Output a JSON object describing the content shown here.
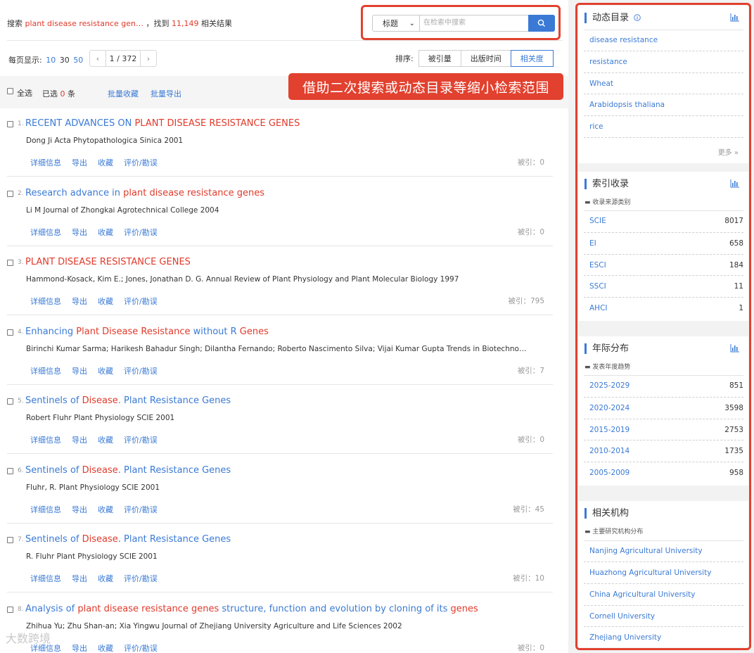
{
  "summary": {
    "prefix": "搜索",
    "keyword": "plant disease resistance gen…",
    "mid": "，找到",
    "count": "11,149",
    "suffix": "相关结果"
  },
  "search": {
    "field": "标题",
    "placeholder": "在检索中搜索"
  },
  "pagination": {
    "per_page_label": "每页显示:",
    "options": [
      "10",
      "30",
      "50"
    ],
    "current_page": "1 / 372",
    "prev": "‹",
    "next": "›"
  },
  "sort": {
    "label": "排序:",
    "options": [
      "被引量",
      "出版时间",
      "相关度"
    ],
    "active": "相关度"
  },
  "toolbar": {
    "select_all": "全选",
    "selected_prefix": "已选",
    "selected_count": "0",
    "selected_suffix": "条",
    "batch_collect": "批量收藏",
    "batch_export": "批量导出"
  },
  "callout": "借助二次搜索或动态目录等缩小检索范围",
  "result_actions": [
    "详细信息",
    "导出",
    "收藏",
    "评价/勘误"
  ],
  "cited_label": "被引：",
  "results": [
    {
      "num": "1.",
      "title": [
        {
          "t": "RECENT ADVANCES ON ",
          "hl": false
        },
        {
          "t": "PLANT DISEASE RESISTANCE GENES",
          "hl": true
        }
      ],
      "meta": "Dong Ji Acta Phytopathologica Sinica 2001",
      "cited": "0"
    },
    {
      "num": "2.",
      "title": [
        {
          "t": "Research advance in ",
          "hl": false
        },
        {
          "t": "plant disease resistance genes",
          "hl": true
        }
      ],
      "meta": "Li M Journal of Zhongkai Agrotechnical College 2004",
      "cited": "0"
    },
    {
      "num": "3.",
      "title": [
        {
          "t": "PLANT DISEASE RESISTANCE GENES",
          "hl": true
        }
      ],
      "meta": "Hammond-Kosack, Kim E.; Jones, Jonathan D. G. Annual Review of Plant Physiology and Plant Molecular Biology 1997",
      "cited": "795"
    },
    {
      "num": "4.",
      "title": [
        {
          "t": "Enhancing ",
          "hl": false
        },
        {
          "t": "Plant Disease Resistance",
          "hl": true
        },
        {
          "t": " without R ",
          "hl": false
        },
        {
          "t": "Genes",
          "hl": true
        }
      ],
      "meta": "Birinchi Kumar Sarma; Harikesh Bahadur Singh; Dilantha Fernando; Roberto Nascimento Silva; Vijai Kumar Gupta Trends in Biotechnology E...",
      "cited": "7"
    },
    {
      "num": "5.",
      "title": [
        {
          "t": "Sentinels of ",
          "hl": false
        },
        {
          "t": "Disease",
          "hl": true
        },
        {
          "t": ". Plant Resistance Genes",
          "hl": false
        }
      ],
      "meta": "Robert Fluhr Plant Physiology SCIE 2001",
      "cited": "0"
    },
    {
      "num": "6.",
      "title": [
        {
          "t": "Sentinels of ",
          "hl": false
        },
        {
          "t": "Disease",
          "hl": true
        },
        {
          "t": ". Plant Resistance Genes",
          "hl": false
        }
      ],
      "meta": "Fluhr, R. Plant Physiology SCIE 2001",
      "cited": "45"
    },
    {
      "num": "7.",
      "title": [
        {
          "t": "Sentinels of ",
          "hl": false
        },
        {
          "t": "Disease",
          "hl": true
        },
        {
          "t": ". Plant Resistance Genes",
          "hl": false
        }
      ],
      "meta": "R. Fluhr Plant Physiology SCIE 2001",
      "cited": "10"
    },
    {
      "num": "8.",
      "title": [
        {
          "t": "Analysis of ",
          "hl": false
        },
        {
          "t": "plant disease resistance genes",
          "hl": true
        },
        {
          "t": " structure, function and evolution by cloning of its ",
          "hl": false
        },
        {
          "t": "genes",
          "hl": true
        }
      ],
      "meta": "Zhihua Yu; Zhu Shan-an; Xia Yingwu Journal of Zhejiang University Agriculture and Life Sciences 2002",
      "cited": "0"
    }
  ],
  "watermark": "大数跨境",
  "panels": {
    "catalog": {
      "title": "动态目录",
      "items": [
        "disease resistance",
        "resistance",
        "Wheat",
        "Arabidopsis thaliana",
        "rice"
      ],
      "more": "更多"
    },
    "index": {
      "title": "索引收录",
      "subtitle": "收录来源类别",
      "items": [
        {
          "k": "SCIE",
          "v": "8017"
        },
        {
          "k": "EI",
          "v": "658"
        },
        {
          "k": "ESCI",
          "v": "184"
        },
        {
          "k": "SSCI",
          "v": "11"
        },
        {
          "k": "AHCI",
          "v": "1"
        }
      ]
    },
    "years": {
      "title": "年际分布",
      "subtitle": "发表年度趋势",
      "items": [
        {
          "k": "2025-2029",
          "v": "851"
        },
        {
          "k": "2020-2024",
          "v": "3598"
        },
        {
          "k": "2015-2019",
          "v": "2753"
        },
        {
          "k": "2010-2014",
          "v": "1735"
        },
        {
          "k": "2005-2009",
          "v": "958"
        }
      ]
    },
    "institutions": {
      "title": "相关机构",
      "subtitle": "主要研究机构分布",
      "items": [
        "Nanjing Agricultural University",
        "Huazhong Agricultural University",
        "China Agricultural University",
        "Cornell University",
        "Zhejiang University"
      ]
    }
  },
  "colors": {
    "accent": "#3a7ad5",
    "highlight": "#e03a2b",
    "annotation": "#e2412f"
  }
}
